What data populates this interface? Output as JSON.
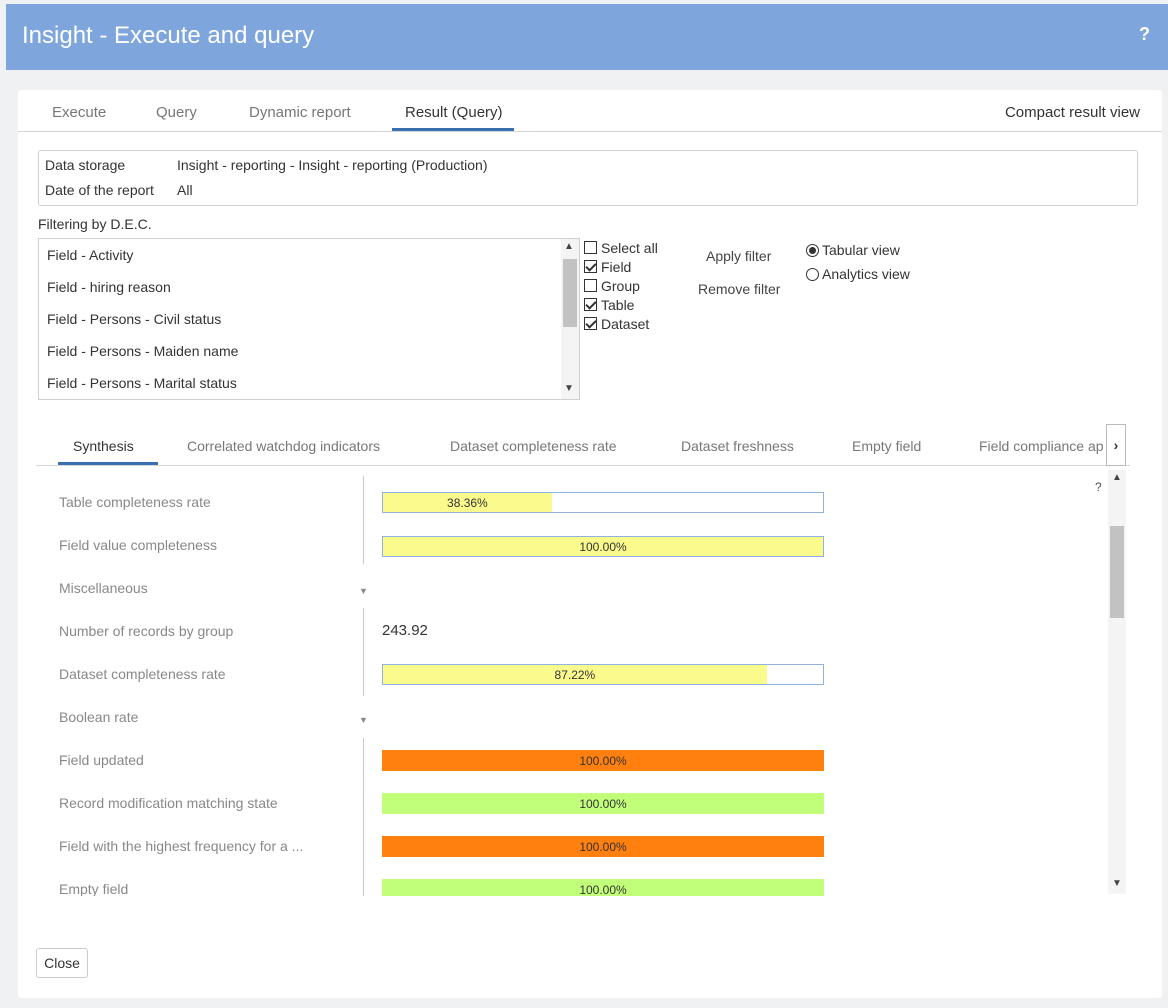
{
  "window": {
    "title": "Insight - Execute and query",
    "help_label": "?"
  },
  "top_tabs": [
    {
      "label": "Execute"
    },
    {
      "label": "Query"
    },
    {
      "label": "Dynamic report"
    },
    {
      "label": "Result (Query)",
      "active": true
    }
  ],
  "compact_label": "Compact result view",
  "info": {
    "storage_key": "Data storage",
    "storage_value": "Insight - reporting - Insight - reporting (Production)",
    "date_key": "Date of the report",
    "date_value": "All"
  },
  "filter": {
    "title": "Filtering by D.E.C.",
    "items": [
      "Field - Activity",
      "Field - hiring reason",
      "Field - Persons - Civil status",
      "Field - Persons - Maiden name",
      "Field - Persons - Marital status"
    ],
    "checkboxes": [
      {
        "label": "Select all",
        "checked": false
      },
      {
        "label": "Field",
        "checked": true
      },
      {
        "label": "Group",
        "checked": false
      },
      {
        "label": "Table",
        "checked": true
      },
      {
        "label": "Dataset",
        "checked": true
      }
    ],
    "apply_label": "Apply filter",
    "remove_label": "Remove filter",
    "views": [
      {
        "label": "Tabular view",
        "selected": true
      },
      {
        "label": "Analytics view",
        "selected": false
      }
    ]
  },
  "sub_tabs": [
    {
      "label": "Synthesis",
      "active": true
    },
    {
      "label": "Correlated watchdog indicators"
    },
    {
      "label": "Dataset completeness rate"
    },
    {
      "label": "Dataset freshness"
    },
    {
      "label": "Empty field"
    },
    {
      "label": "Field compliance ap"
    }
  ],
  "help_mark": "?",
  "colors": {
    "yellow": "#fbfa8c",
    "orange": "#ff7f0f",
    "green": "#c1ff7a",
    "accent": "#3a6fb0",
    "titlebar": "#7ea6dc"
  },
  "rows": [
    {
      "label": "Table completeness rate",
      "type": "bar",
      "value": "38.36%",
      "fill": 0.3836,
      "color": "yellow",
      "style": "outlined"
    },
    {
      "label": "Field value completeness",
      "type": "bar",
      "value": "100.00%",
      "fill": 1.0,
      "color": "yellow",
      "style": "outlined"
    },
    {
      "label": "Miscellaneous",
      "type": "group"
    },
    {
      "label": "Number of records by group",
      "type": "number",
      "value": "243.92"
    },
    {
      "label": "Dataset completeness rate",
      "type": "bar",
      "value": "87.22%",
      "fill": 0.8722,
      "color": "yellow",
      "style": "outlined"
    },
    {
      "label": "Boolean rate",
      "type": "group"
    },
    {
      "label": "Field updated",
      "type": "bar",
      "value": "100.00%",
      "fill": 1.0,
      "color": "orange",
      "style": "solid"
    },
    {
      "label": "Record modification matching state",
      "type": "bar",
      "value": "100.00%",
      "fill": 1.0,
      "color": "green",
      "style": "solid"
    },
    {
      "label": "Field with the highest frequency for a ...",
      "type": "bar",
      "value": "100.00%",
      "fill": 1.0,
      "color": "orange",
      "style": "solid"
    },
    {
      "label": "Empty field",
      "type": "bar",
      "value": "100.00%",
      "fill": 1.0,
      "color": "green",
      "style": "solid"
    }
  ],
  "close_label": "Close"
}
